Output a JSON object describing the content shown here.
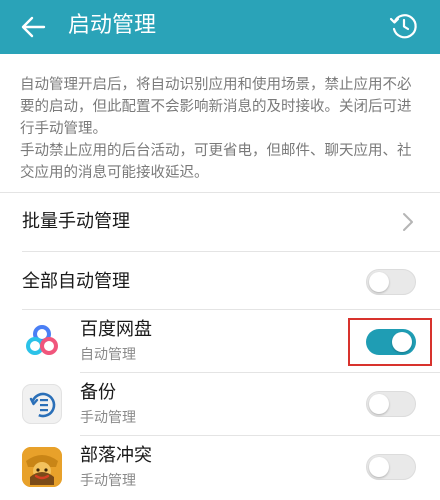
{
  "header": {
    "title": "启动管理",
    "back_icon": "arrow-left-icon",
    "history_icon": "history-clock-icon",
    "bg_color": "#2aa3b8"
  },
  "description": {
    "line1": "自动管理开启后，将自动识别应用和使用场景，禁止应用不必要的启动，但此配置不会影响新消息的及时接收。关闭后可进行手动管理。",
    "line2": "手动禁止应用的后台活动，可更省电，但邮件、聊天应用、社交应用的消息可能接收延迟。"
  },
  "settings": {
    "batch_manual": {
      "label": "批量手动管理",
      "icon": "chevron-right-icon"
    },
    "all_auto": {
      "label": "全部自动管理",
      "enabled": false
    }
  },
  "apps": [
    {
      "name": "百度网盘",
      "mode": "自动管理",
      "enabled": true,
      "icon": "baidu-netdisk-icon"
    },
    {
      "name": "备份",
      "mode": "手动管理",
      "enabled": false,
      "icon": "backup-icon"
    },
    {
      "name": "部落冲突",
      "mode": "手动管理",
      "enabled": false,
      "icon": "clash-of-clans-icon"
    }
  ],
  "colors": {
    "toggle_on": "#1f9db4",
    "toggle_off": "#e9e9e9",
    "highlight": "#d8322d"
  }
}
